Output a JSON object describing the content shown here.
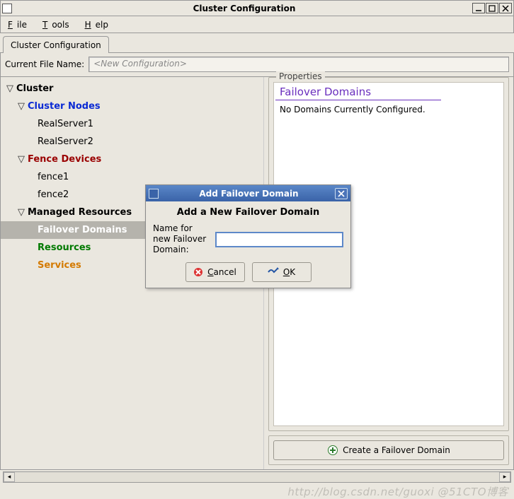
{
  "window": {
    "title": "Cluster Configuration"
  },
  "menu": {
    "file": "File",
    "tools": "Tools",
    "help": "Help"
  },
  "tab": {
    "label": "Cluster Configuration"
  },
  "filename": {
    "label": "Current File Name:",
    "placeholder": "<New Configuration>"
  },
  "tree": {
    "root": "Cluster",
    "nodes_label": "Cluster Nodes",
    "nodes": [
      "RealServer1",
      "RealServer2"
    ],
    "fence_label": "Fence Devices",
    "fences": [
      "fence1",
      "fence2"
    ],
    "managed_label": "Managed Resources",
    "failover": "Failover Domains",
    "resources": "Resources",
    "services": "Services"
  },
  "properties": {
    "legend": "Properties",
    "heading": "Failover Domains",
    "message": "No Domains Currently Configured.",
    "create_label": "Create a Failover Domain"
  },
  "dialog": {
    "title": "Add Failover Domain",
    "heading": "Add a New Failover Domain",
    "field_label": "Name for new Failover Domain:",
    "value": "",
    "cancel": "Cancel",
    "ok": "OK"
  },
  "watermark": "http://blog.csdn.net/guoxi   @51CTO博客"
}
